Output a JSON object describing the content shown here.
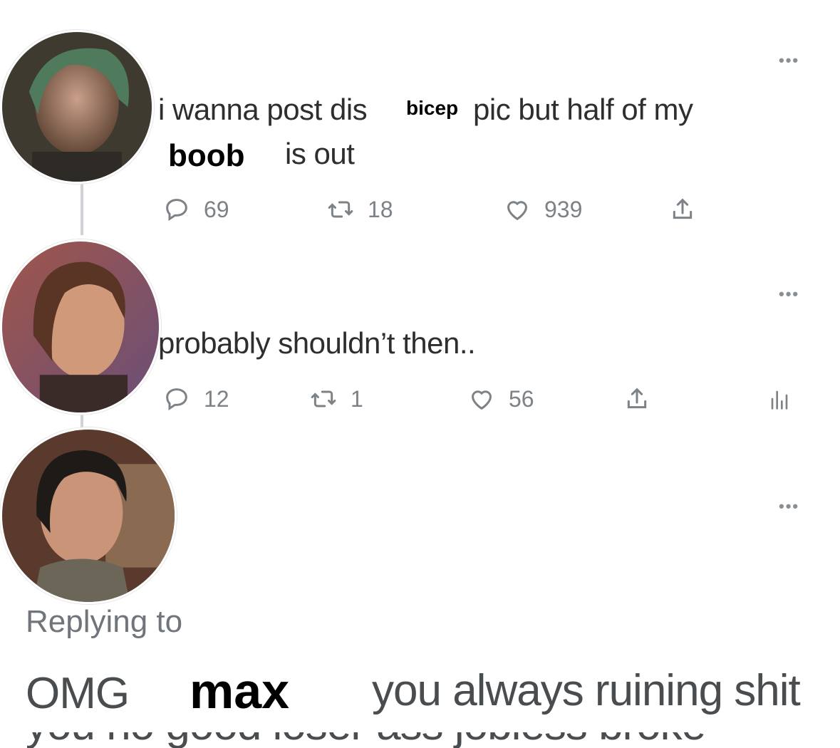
{
  "tweets": [
    {
      "text_part1": "i wanna post dis",
      "overlay_word_1": "bicep",
      "text_part2": "pic but half of my",
      "overlay_word_2": "boob",
      "text_part3": "is out",
      "replies": "69",
      "retweets": "18",
      "likes": "939"
    },
    {
      "text": "probably shouldn’t then..",
      "replies": "12",
      "retweets": "1",
      "likes": "56"
    }
  ],
  "reply_box": {
    "replying_to": "Replying to",
    "text_omg": "OMG",
    "overlay_name": "max",
    "text_rest": "you always ruining shit",
    "text_cutoff": "you no good loser ass jobless broke"
  },
  "icons": {
    "reply": "reply-icon",
    "retweet": "retweet-icon",
    "like": "heart-icon",
    "share": "share-icon",
    "analytics": "analytics-icon",
    "more": "more-icon"
  },
  "colors": {
    "icon_gray": "#7d8287",
    "thread_line": "#cfd2d6"
  }
}
